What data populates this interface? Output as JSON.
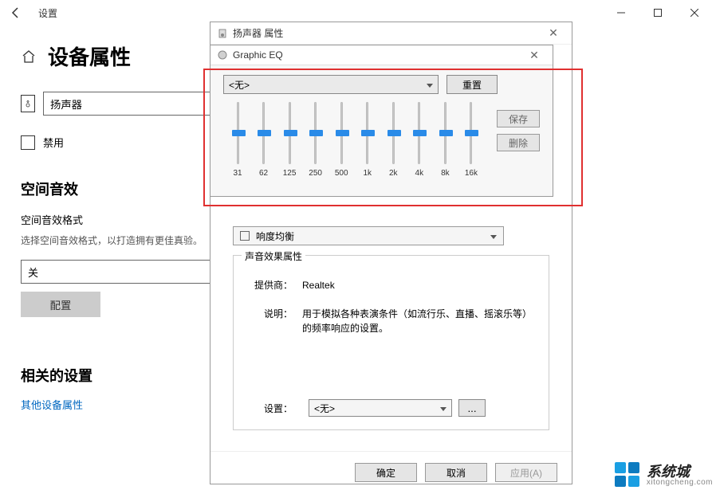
{
  "settings": {
    "titlebar_title": "设置",
    "heading": "设备属性",
    "device_name": "扬声器",
    "disable_label": "禁用",
    "spatial_heading": "空间音效",
    "spatial_format_label": "空间音效格式",
    "spatial_desc": "选择空间音效格式，以打造拥有更佳真验。",
    "off_value": "关",
    "config_label": "配置",
    "related_heading": "相关的设置",
    "other_props_link": "其他设备属性"
  },
  "speaker_dialog": {
    "title": "扬声器 属性",
    "partial_checkbox_label": "响度均衡",
    "group_title": "声音效果属性",
    "provider_label": "提供商：",
    "provider_value": "Realtek",
    "desc_label": "说明：",
    "desc_value": "用于模拟各种表演条件（如流行乐、直播、摇滚乐等）的频率响应的设置。",
    "settings_label": "设置：",
    "preset_value": "<无>",
    "more_label": "...",
    "ok_label": "确定",
    "cancel_label": "取消",
    "apply_label": "应用(A)"
  },
  "eq": {
    "title": "Graphic EQ",
    "preset_value": "<无>",
    "reset_label": "重置",
    "save_label": "保存",
    "delete_label": "删除",
    "bands": [
      "31",
      "62",
      "125",
      "250",
      "500",
      "1k",
      "2k",
      "4k",
      "8k",
      "16k"
    ]
  },
  "watermark": {
    "cn": "系统城",
    "en": "xitongcheng.com"
  }
}
